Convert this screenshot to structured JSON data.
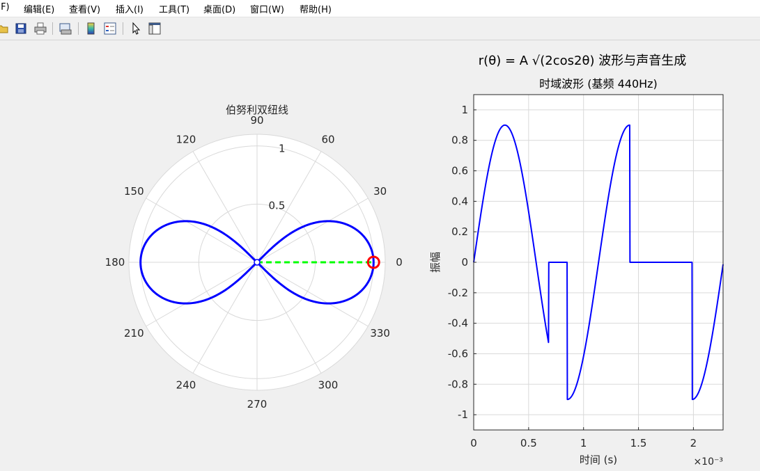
{
  "menu": {
    "items": [
      "(F)",
      "编辑(E)",
      "查看(V)",
      "插入(I)",
      "工具(T)",
      "桌面(D)",
      "窗口(W)",
      "帮助(H)"
    ]
  },
  "toolbar": {
    "icons": [
      "open-file-icon",
      "save-icon",
      "print-icon",
      "print-preview-icon",
      "colorbar-icon",
      "legend-icon",
      "pointer-icon",
      "property-editor-icon"
    ]
  },
  "figure": {
    "sgtitle": "r(θ) = A √(2cos2θ) 波形与声音生成"
  },
  "colors": {
    "curve": "#0000ff",
    "ray": "#00ff00",
    "marker": "#ff0000",
    "grid": "#d9d9d9",
    "axes_bg": "#ffffff",
    "figure_bg": "#f0f0f0"
  },
  "chart_data": [
    {
      "type": "line",
      "subtype": "polar",
      "title": "伯努利双纽线",
      "theta_ticks": [
        "0",
        "30",
        "60",
        "90",
        "120",
        "150",
        "180",
        "210",
        "240",
        "270",
        "300",
        "330"
      ],
      "r_ticks": [
        "0.5",
        "1"
      ],
      "rlim": [
        0,
        1.1
      ],
      "series": [
        {
          "style": "solid blue line",
          "equation": "r = sqrt(cos(2θ))"
        },
        {
          "style": "dashed green line",
          "theta_deg": 0,
          "r": [
            0,
            1
          ]
        },
        {
          "style": "red circle marker",
          "theta_deg": 0,
          "r": 1
        }
      ],
      "grid": true
    },
    {
      "type": "line",
      "title": "时域波形 (基频 440Hz)",
      "xlabel": "时间 (s)",
      "ylabel": "振幅",
      "x_exponent": "×10⁻³",
      "xlim": [
        0,
        0.00227
      ],
      "ylim": [
        -1.1,
        1.1
      ],
      "x_ticks": [
        "0",
        "0.5",
        "1",
        "1.5",
        "2"
      ],
      "y_ticks": [
        "-1",
        "-0.8",
        "-0.6",
        "-0.4",
        "-0.2",
        "0",
        "0.2",
        "0.4",
        "0.6",
        "0.8",
        "1"
      ],
      "frequency_hz": 440,
      "peak_amplitude": 0.9,
      "grid": true
    }
  ]
}
